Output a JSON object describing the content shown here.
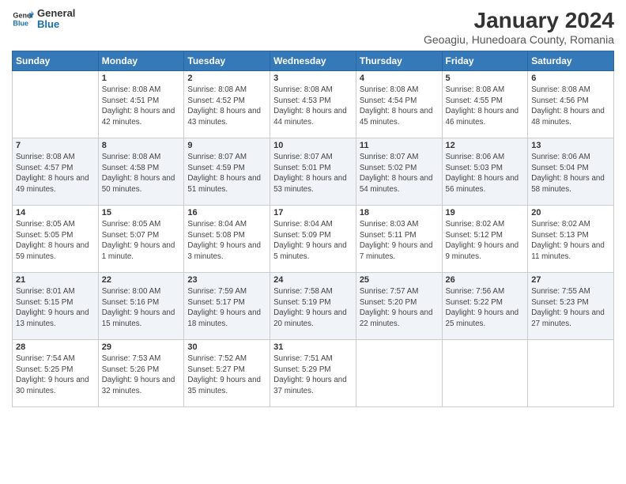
{
  "logo": {
    "line1": "General",
    "line2": "Blue"
  },
  "title": "January 2024",
  "subtitle": "Geoagiu, Hunedoara County, Romania",
  "headers": [
    "Sunday",
    "Monday",
    "Tuesday",
    "Wednesday",
    "Thursday",
    "Friday",
    "Saturday"
  ],
  "weeks": [
    [
      {
        "num": "",
        "sunrise": "",
        "sunset": "",
        "daylight": ""
      },
      {
        "num": "1",
        "sunrise": "Sunrise: 8:08 AM",
        "sunset": "Sunset: 4:51 PM",
        "daylight": "Daylight: 8 hours and 42 minutes."
      },
      {
        "num": "2",
        "sunrise": "Sunrise: 8:08 AM",
        "sunset": "Sunset: 4:52 PM",
        "daylight": "Daylight: 8 hours and 43 minutes."
      },
      {
        "num": "3",
        "sunrise": "Sunrise: 8:08 AM",
        "sunset": "Sunset: 4:53 PM",
        "daylight": "Daylight: 8 hours and 44 minutes."
      },
      {
        "num": "4",
        "sunrise": "Sunrise: 8:08 AM",
        "sunset": "Sunset: 4:54 PM",
        "daylight": "Daylight: 8 hours and 45 minutes."
      },
      {
        "num": "5",
        "sunrise": "Sunrise: 8:08 AM",
        "sunset": "Sunset: 4:55 PM",
        "daylight": "Daylight: 8 hours and 46 minutes."
      },
      {
        "num": "6",
        "sunrise": "Sunrise: 8:08 AM",
        "sunset": "Sunset: 4:56 PM",
        "daylight": "Daylight: 8 hours and 48 minutes."
      }
    ],
    [
      {
        "num": "7",
        "sunrise": "Sunrise: 8:08 AM",
        "sunset": "Sunset: 4:57 PM",
        "daylight": "Daylight: 8 hours and 49 minutes."
      },
      {
        "num": "8",
        "sunrise": "Sunrise: 8:08 AM",
        "sunset": "Sunset: 4:58 PM",
        "daylight": "Daylight: 8 hours and 50 minutes."
      },
      {
        "num": "9",
        "sunrise": "Sunrise: 8:07 AM",
        "sunset": "Sunset: 4:59 PM",
        "daylight": "Daylight: 8 hours and 51 minutes."
      },
      {
        "num": "10",
        "sunrise": "Sunrise: 8:07 AM",
        "sunset": "Sunset: 5:01 PM",
        "daylight": "Daylight: 8 hours and 53 minutes."
      },
      {
        "num": "11",
        "sunrise": "Sunrise: 8:07 AM",
        "sunset": "Sunset: 5:02 PM",
        "daylight": "Daylight: 8 hours and 54 minutes."
      },
      {
        "num": "12",
        "sunrise": "Sunrise: 8:06 AM",
        "sunset": "Sunset: 5:03 PM",
        "daylight": "Daylight: 8 hours and 56 minutes."
      },
      {
        "num": "13",
        "sunrise": "Sunrise: 8:06 AM",
        "sunset": "Sunset: 5:04 PM",
        "daylight": "Daylight: 8 hours and 58 minutes."
      }
    ],
    [
      {
        "num": "14",
        "sunrise": "Sunrise: 8:05 AM",
        "sunset": "Sunset: 5:05 PM",
        "daylight": "Daylight: 8 hours and 59 minutes."
      },
      {
        "num": "15",
        "sunrise": "Sunrise: 8:05 AM",
        "sunset": "Sunset: 5:07 PM",
        "daylight": "Daylight: 9 hours and 1 minute."
      },
      {
        "num": "16",
        "sunrise": "Sunrise: 8:04 AM",
        "sunset": "Sunset: 5:08 PM",
        "daylight": "Daylight: 9 hours and 3 minutes."
      },
      {
        "num": "17",
        "sunrise": "Sunrise: 8:04 AM",
        "sunset": "Sunset: 5:09 PM",
        "daylight": "Daylight: 9 hours and 5 minutes."
      },
      {
        "num": "18",
        "sunrise": "Sunrise: 8:03 AM",
        "sunset": "Sunset: 5:11 PM",
        "daylight": "Daylight: 9 hours and 7 minutes."
      },
      {
        "num": "19",
        "sunrise": "Sunrise: 8:02 AM",
        "sunset": "Sunset: 5:12 PM",
        "daylight": "Daylight: 9 hours and 9 minutes."
      },
      {
        "num": "20",
        "sunrise": "Sunrise: 8:02 AM",
        "sunset": "Sunset: 5:13 PM",
        "daylight": "Daylight: 9 hours and 11 minutes."
      }
    ],
    [
      {
        "num": "21",
        "sunrise": "Sunrise: 8:01 AM",
        "sunset": "Sunset: 5:15 PM",
        "daylight": "Daylight: 9 hours and 13 minutes."
      },
      {
        "num": "22",
        "sunrise": "Sunrise: 8:00 AM",
        "sunset": "Sunset: 5:16 PM",
        "daylight": "Daylight: 9 hours and 15 minutes."
      },
      {
        "num": "23",
        "sunrise": "Sunrise: 7:59 AM",
        "sunset": "Sunset: 5:17 PM",
        "daylight": "Daylight: 9 hours and 18 minutes."
      },
      {
        "num": "24",
        "sunrise": "Sunrise: 7:58 AM",
        "sunset": "Sunset: 5:19 PM",
        "daylight": "Daylight: 9 hours and 20 minutes."
      },
      {
        "num": "25",
        "sunrise": "Sunrise: 7:57 AM",
        "sunset": "Sunset: 5:20 PM",
        "daylight": "Daylight: 9 hours and 22 minutes."
      },
      {
        "num": "26",
        "sunrise": "Sunrise: 7:56 AM",
        "sunset": "Sunset: 5:22 PM",
        "daylight": "Daylight: 9 hours and 25 minutes."
      },
      {
        "num": "27",
        "sunrise": "Sunrise: 7:55 AM",
        "sunset": "Sunset: 5:23 PM",
        "daylight": "Daylight: 9 hours and 27 minutes."
      }
    ],
    [
      {
        "num": "28",
        "sunrise": "Sunrise: 7:54 AM",
        "sunset": "Sunset: 5:25 PM",
        "daylight": "Daylight: 9 hours and 30 minutes."
      },
      {
        "num": "29",
        "sunrise": "Sunrise: 7:53 AM",
        "sunset": "Sunset: 5:26 PM",
        "daylight": "Daylight: 9 hours and 32 minutes."
      },
      {
        "num": "30",
        "sunrise": "Sunrise: 7:52 AM",
        "sunset": "Sunset: 5:27 PM",
        "daylight": "Daylight: 9 hours and 35 minutes."
      },
      {
        "num": "31",
        "sunrise": "Sunrise: 7:51 AM",
        "sunset": "Sunset: 5:29 PM",
        "daylight": "Daylight: 9 hours and 37 minutes."
      },
      {
        "num": "",
        "sunrise": "",
        "sunset": "",
        "daylight": ""
      },
      {
        "num": "",
        "sunrise": "",
        "sunset": "",
        "daylight": ""
      },
      {
        "num": "",
        "sunrise": "",
        "sunset": "",
        "daylight": ""
      }
    ]
  ]
}
